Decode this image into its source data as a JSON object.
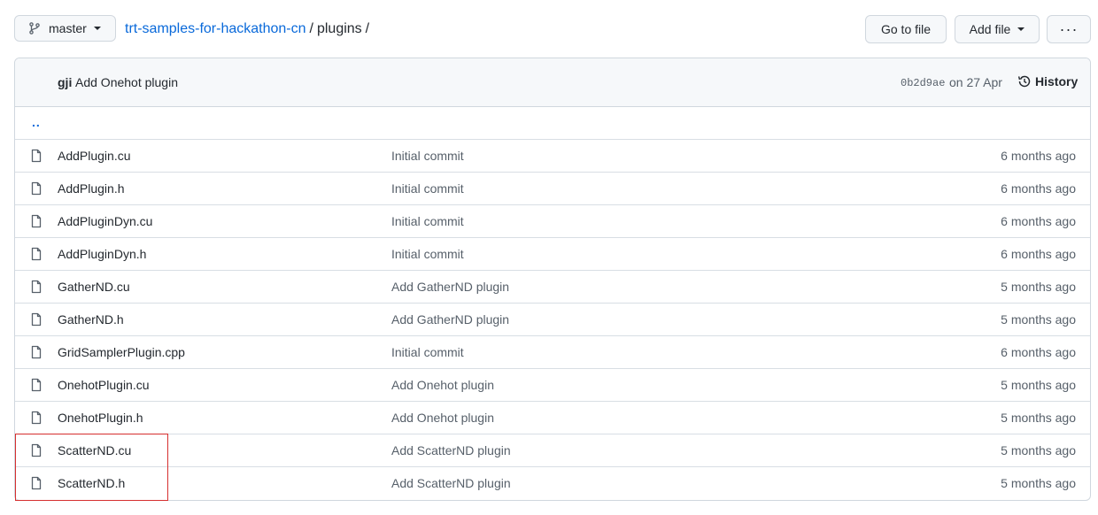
{
  "branch": {
    "name": "master",
    "icon": "branch-icon"
  },
  "breadcrumb": {
    "repo": "trt-samples-for-hackathon-cn",
    "sep1": "/",
    "folder": "plugins",
    "sep2": "/"
  },
  "toolbar": {
    "goto_label": "Go to file",
    "addfile_label": "Add file",
    "more_label": "···"
  },
  "commit": {
    "author": "gji",
    "message": "Add Onehot plugin",
    "sha": "0b2d9ae",
    "date": "on 27 Apr",
    "history_label": "History"
  },
  "parent_link": "..",
  "files": [
    {
      "name": "AddPlugin.cu",
      "message": "Initial commit",
      "age": "6 months ago"
    },
    {
      "name": "AddPlugin.h",
      "message": "Initial commit",
      "age": "6 months ago"
    },
    {
      "name": "AddPluginDyn.cu",
      "message": "Initial commit",
      "age": "6 months ago"
    },
    {
      "name": "AddPluginDyn.h",
      "message": "Initial commit",
      "age": "6 months ago"
    },
    {
      "name": "GatherND.cu",
      "message": "Add GatherND plugin",
      "age": "5 months ago"
    },
    {
      "name": "GatherND.h",
      "message": "Add GatherND plugin",
      "age": "5 months ago"
    },
    {
      "name": "GridSamplerPlugin.cpp",
      "message": "Initial commit",
      "age": "6 months ago"
    },
    {
      "name": "OnehotPlugin.cu",
      "message": "Add Onehot plugin",
      "age": "5 months ago"
    },
    {
      "name": "OnehotPlugin.h",
      "message": "Add Onehot plugin",
      "age": "5 months ago"
    },
    {
      "name": "ScatterND.cu",
      "message": "Add ScatterND plugin",
      "age": "5 months ago"
    },
    {
      "name": "ScatterND.h",
      "message": "Add ScatterND plugin",
      "age": "5 months ago"
    }
  ],
  "colors": {
    "link": "#0969da",
    "highlight": "#d62f2f",
    "muted": "#57606a"
  }
}
